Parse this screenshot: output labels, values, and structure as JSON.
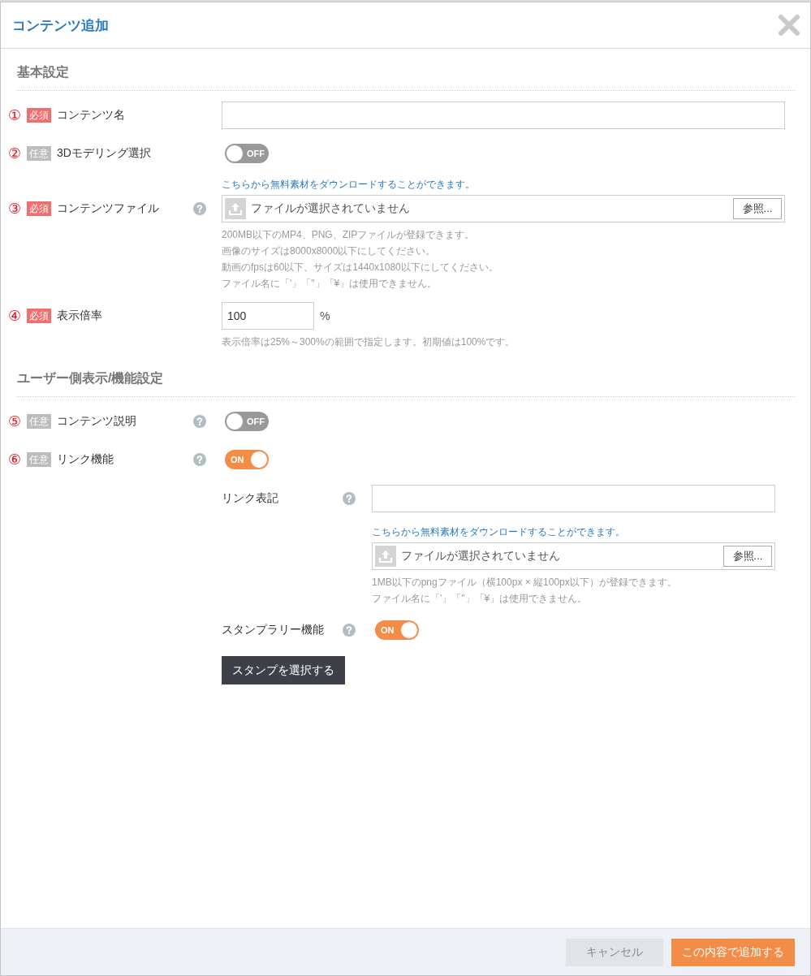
{
  "dialog": {
    "title": "コンテンツ追加"
  },
  "sections": [
    {
      "heading": "基本設定",
      "fields": [
        {
          "number": "①",
          "badge": "必須",
          "required": true,
          "label": "コンテンツ名",
          "help": false,
          "controls": [
            {
              "kind": "input"
            }
          ]
        },
        {
          "number": "②",
          "badge": "任意",
          "required": false,
          "label": "3Dモデリング選択",
          "help": false,
          "controls": [
            {
              "kind": "toggle",
              "on": false,
              "text": "OFF"
            }
          ]
        },
        {
          "number": "③",
          "badge": "必須",
          "required": true,
          "label": "コンテンツファイル",
          "help": true,
          "controls": [
            {
              "kind": "link",
              "text": "こちらから無料素材をダウンロードすることができます。"
            },
            {
              "kind": "file",
              "status": "ファイルが選択されていません",
              "browse": "参照..."
            },
            {
              "kind": "notes",
              "lines": [
                "200MB以下のMP4、PNG、ZIPファイルが登録できます。",
                "画像のサイズは8000x8000以下にしてください。",
                "動画のfpsは60以下、サイズは1440x1080以下にしてください。",
                "ファイル名に「'」「\"」「¥」は使用できません。"
              ]
            }
          ]
        },
        {
          "number": "④",
          "badge": "必須",
          "required": true,
          "label": "表示倍率",
          "help": false,
          "controls": [
            {
              "kind": "number",
              "value": "100",
              "unit": "%"
            },
            {
              "kind": "notes",
              "lines": [
                "表示倍率は25%～300%の範囲で指定します。初期値は100%です。"
              ]
            }
          ]
        }
      ]
    },
    {
      "heading": "ユーザー側表示/機能設定",
      "fields": [
        {
          "number": "⑤",
          "badge": "任意",
          "required": false,
          "label": "コンテンツ説明",
          "help": true,
          "controls": [
            {
              "kind": "toggle",
              "on": false,
              "text": "OFF"
            }
          ]
        },
        {
          "number": "⑥",
          "badge": "任意",
          "required": false,
          "label": "リンク機能",
          "help": true,
          "controls": [
            {
              "kind": "toggle",
              "on": true,
              "text": "ON"
            }
          ],
          "children": [
            {
              "kind": "field",
              "label": "リンク表記",
              "help": true,
              "controls": [
                {
                  "kind": "input"
                },
                {
                  "kind": "link",
                  "text": "こちらから無料素材をダウンロードすることができます。"
                },
                {
                  "kind": "file",
                  "status": "ファイルが選択されていません",
                  "browse": "参照..."
                },
                {
                  "kind": "notes",
                  "lines": [
                    "1MB以下のpngファイル（横100px × 縦100px以下）が登録できます。",
                    "ファイル名に「'」「\"」「¥」は使用できません。"
                  ]
                }
              ]
            },
            {
              "kind": "field",
              "label": "スタンプラリー機能",
              "help": true,
              "controls": [
                {
                  "kind": "toggle",
                  "on": true,
                  "text": "ON"
                }
              ]
            },
            {
              "kind": "button",
              "label": "スタンプを選択する"
            }
          ]
        }
      ]
    }
  ],
  "footer": {
    "buttons": [
      {
        "label": "キャンセル",
        "primary": false
      },
      {
        "label": "この内容で追加する",
        "primary": true
      }
    ]
  }
}
